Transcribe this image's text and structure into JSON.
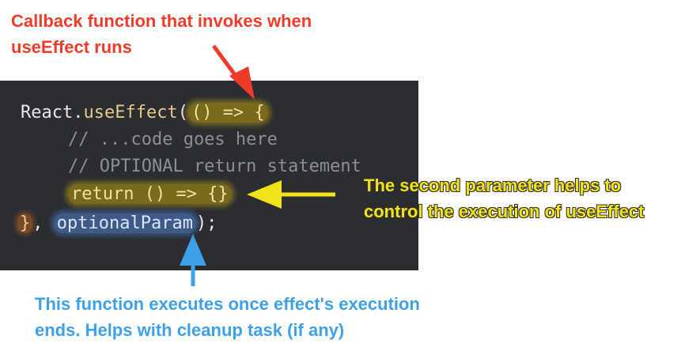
{
  "code": {
    "line1": {
      "obj": "React.",
      "fn": "useEffect",
      "paren": "(",
      "callback": "() => {"
    },
    "line2": "// ...code goes here",
    "line3": "// OPTIONAL return statement",
    "line4": {
      "return": "return () => {}"
    },
    "line5": {
      "close": "}",
      "comma": ", ",
      "param": "optionalParam",
      "end": ");"
    }
  },
  "annotations": {
    "callback": [
      "Callback function that invokes when",
      "useEffect runs"
    ],
    "second_param": [
      "The second parameter helps to",
      "control the execution of useEffect"
    ],
    "cleanup": [
      "This function executes once effect's execution",
      "ends. Helps with cleanup task (if any)"
    ]
  },
  "colors": {
    "red": "#ef3b2a",
    "yellow": "#f2e21a",
    "blue": "#3ea0e8",
    "panel": "#2b2d31"
  }
}
